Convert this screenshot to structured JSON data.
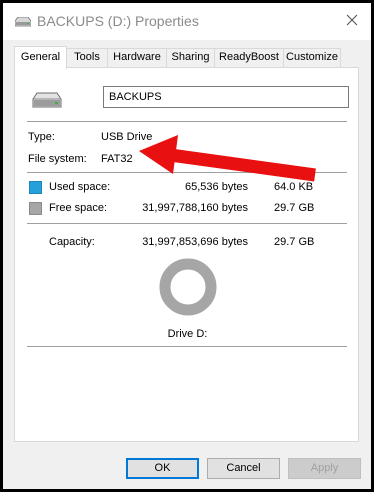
{
  "window": {
    "title": "BACKUPS (D:) Properties",
    "close_icon": "close-icon"
  },
  "tabs": [
    {
      "label": "General",
      "active": true
    },
    {
      "label": "Tools"
    },
    {
      "label": "Hardware"
    },
    {
      "label": "Sharing"
    },
    {
      "label": "ReadyBoost"
    },
    {
      "label": "Customize"
    }
  ],
  "general": {
    "drive_name": "BACKUPS",
    "type_label": "Type:",
    "type_value": "USB Drive",
    "fs_label": "File system:",
    "fs_value": "FAT32",
    "used": {
      "label": "Used space:",
      "bytes": "65,536 bytes",
      "size": "64.0 KB",
      "color": "#26a0da"
    },
    "free": {
      "label": "Free space:",
      "bytes": "31,997,788,160 bytes",
      "size": "29.7 GB",
      "color": "#a6a6a6"
    },
    "capacity": {
      "label": "Capacity:",
      "bytes": "31,997,853,696 bytes",
      "size": "29.7 GB"
    },
    "drive_caption": "Drive D:",
    "usage_fraction_used": 2e-06
  },
  "annotation": {
    "arrow_color": "#e81010"
  },
  "buttons": {
    "ok": "OK",
    "cancel": "Cancel",
    "apply": "Apply"
  }
}
